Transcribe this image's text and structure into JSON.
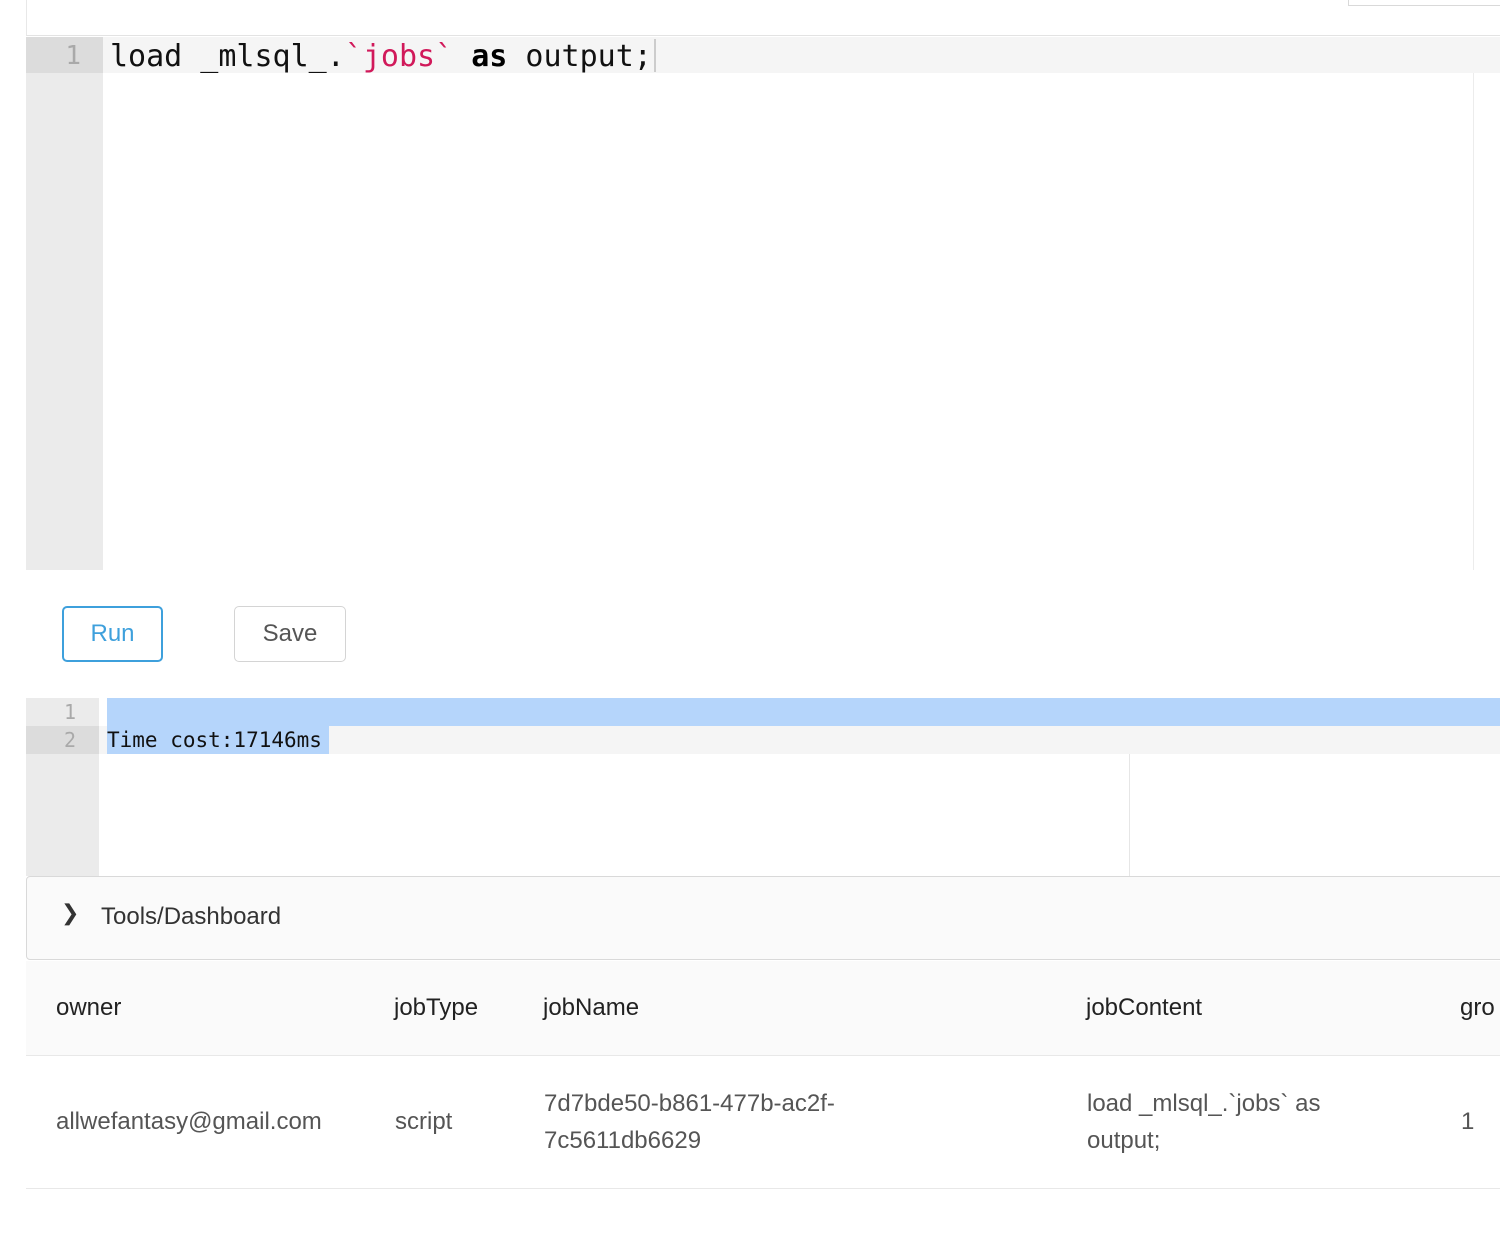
{
  "editor": {
    "line_number": "1",
    "code": {
      "t1": "load _mlsql_.",
      "t2": "`jobs`",
      "t3": " ",
      "t4": "as",
      "t5": " output;"
    }
  },
  "buttons": {
    "run": "Run",
    "save": "Save"
  },
  "output": {
    "line_numbers": [
      "1",
      "2"
    ],
    "text": "Time cost:17146ms"
  },
  "collapse": {
    "icon": "chevron-right-icon",
    "title": "Tools/Dashboard"
  },
  "table": {
    "columns": [
      "owner",
      "jobType",
      "jobName",
      "jobContent",
      "gro"
    ],
    "rows": [
      {
        "owner": "allwefantasy@gmail.com",
        "jobType": "script",
        "jobName": [
          "7d7bde50-b861-477b-ac2f-",
          "7c5611db6629"
        ],
        "jobContent": [
          "load _mlsql_.`jobs` as",
          "output;"
        ],
        "group": "1"
      }
    ]
  },
  "colors": {
    "accent": "#3ea0dc",
    "string": "#d1195a",
    "selection": "#b5d5fb"
  }
}
